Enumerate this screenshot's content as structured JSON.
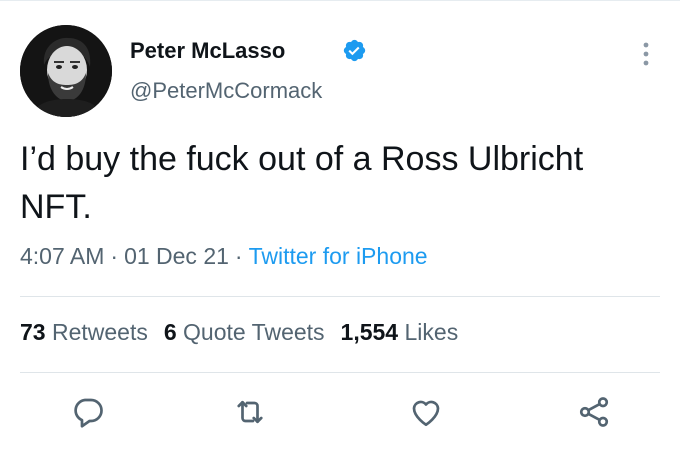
{
  "tweet": {
    "author": {
      "display_name": "Peter McLasso",
      "handle": "@PeterMcCormack",
      "verified": true
    },
    "text": "I’d buy the fuck out of a Ross Ulbricht NFT.",
    "time": "4:07 AM",
    "date": "01 Dec 21",
    "separator": "·",
    "source": "Twitter for iPhone",
    "stats": {
      "retweets_count": "73",
      "retweets_label": "Retweets",
      "quotes_count": "6",
      "quotes_label": "Quote Tweets",
      "likes_count": "1,554",
      "likes_label": "Likes"
    }
  },
  "icons": {
    "verified": "verified-badge-icon",
    "more": "more-vertical-icon",
    "reply": "reply-icon",
    "retweet": "retweet-icon",
    "like": "heart-icon",
    "share": "share-icon"
  },
  "colors": {
    "accent": "#1d9bf0",
    "secondary_text": "#536471",
    "primary_text": "#0f1419",
    "divider": "#dfe5e9"
  }
}
